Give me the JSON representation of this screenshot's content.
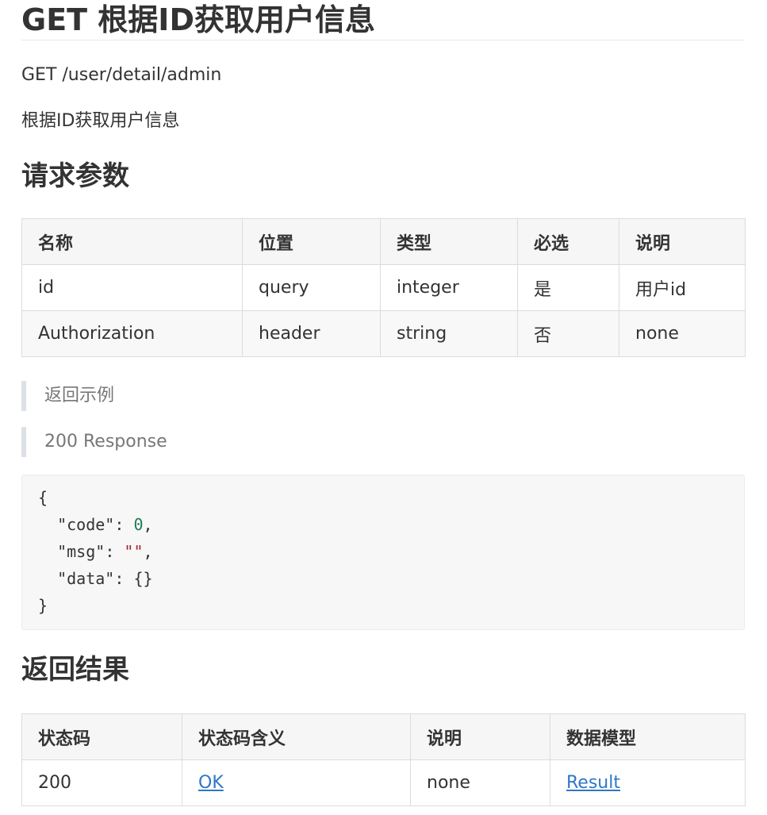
{
  "title": "GET 根据ID获取用户信息",
  "endpoint": "GET /user/detail/admin",
  "description": "根据ID获取用户信息",
  "params_section": {
    "heading": "请求参数",
    "columns": [
      "名称",
      "位置",
      "类型",
      "必选",
      "说明"
    ],
    "rows": [
      [
        "id",
        "query",
        "integer",
        "是",
        "用户id"
      ],
      [
        "Authorization",
        "header",
        "string",
        "否",
        "none"
      ]
    ]
  },
  "example": {
    "label": "返回示例",
    "response_label": "200 Response",
    "code": {
      "open": "{",
      "code_key": "\"code\"",
      "code_value": "0",
      "msg_key": "\"msg\"",
      "msg_value": "\"\"",
      "data_key": "\"data\"",
      "data_value": "{}",
      "close": "}"
    }
  },
  "results_section": {
    "heading": "返回结果",
    "columns": [
      "状态码",
      "状态码含义",
      "说明",
      "数据模型"
    ],
    "rows": [
      {
        "status": "200",
        "meaning": "OK",
        "description": "none",
        "model": "Result"
      }
    ]
  },
  "colors": {
    "text": "#333333",
    "link": "#2e77c6",
    "number": "#1c7c54",
    "string": "#a3262c",
    "quote_border": "#dde1e6"
  }
}
